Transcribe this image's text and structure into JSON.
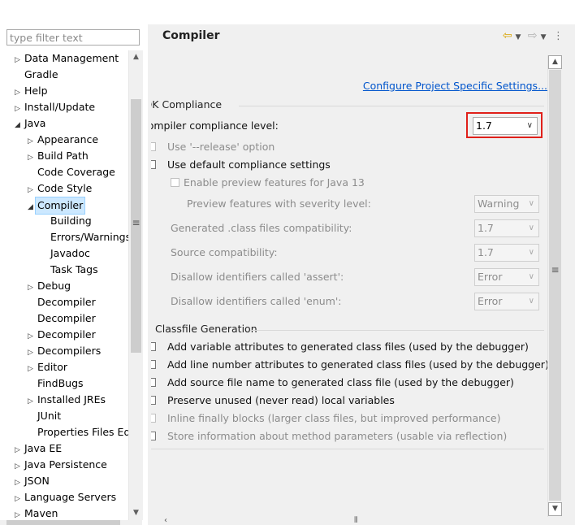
{
  "filter": {
    "placeholder": "type filter text"
  },
  "tree": {
    "items": [
      {
        "label": "Data Management",
        "twisty": "▷"
      },
      {
        "label": "Gradle",
        "twisty": ""
      },
      {
        "label": "Help",
        "twisty": "▷"
      },
      {
        "label": "Install/Update",
        "twisty": "▷"
      },
      {
        "label": "Java",
        "twisty": "◢"
      },
      {
        "label": "Appearance",
        "twisty": "▷"
      },
      {
        "label": "Build Path",
        "twisty": "▷"
      },
      {
        "label": "Code Coverage",
        "twisty": ""
      },
      {
        "label": "Code Style",
        "twisty": "▷"
      },
      {
        "label": "Compiler",
        "twisty": "◢"
      },
      {
        "label": "Building",
        "twisty": ""
      },
      {
        "label": "Errors/Warnings",
        "twisty": ""
      },
      {
        "label": "Javadoc",
        "twisty": ""
      },
      {
        "label": "Task Tags",
        "twisty": ""
      },
      {
        "label": "Debug",
        "twisty": "▷"
      },
      {
        "label": "Decompiler",
        "twisty": ""
      },
      {
        "label": "Decompiler",
        "twisty": ""
      },
      {
        "label": "Decompiler",
        "twisty": "▷"
      },
      {
        "label": "Decompilers",
        "twisty": "▷"
      },
      {
        "label": "Editor",
        "twisty": "▷"
      },
      {
        "label": "FindBugs",
        "twisty": ""
      },
      {
        "label": "Installed JREs",
        "twisty": "▷"
      },
      {
        "label": "JUnit",
        "twisty": ""
      },
      {
        "label": "Properties Files Edi",
        "twisty": ""
      },
      {
        "label": "Java EE",
        "twisty": "▷"
      },
      {
        "label": "Java Persistence",
        "twisty": "▷"
      },
      {
        "label": "JSON",
        "twisty": "▷"
      },
      {
        "label": "Language Servers",
        "twisty": "▷"
      },
      {
        "label": "Maven",
        "twisty": "▷"
      }
    ],
    "selected": "Compiler"
  },
  "page": {
    "title": "Compiler",
    "configure_link": "Configure Project Specific Settings..."
  },
  "jdk": {
    "section_title": "JDK Compliance",
    "compliance_label": "Compiler compliance level:",
    "compliance_value": "1.7",
    "release_label": "Use '--release' option",
    "default_label": "Use default compliance settings",
    "preview_label": "Enable preview features for Java 13",
    "severity_label": "Preview features with severity level:",
    "severity_value": "Warning",
    "generated_label": "Generated .class files compatibility:",
    "generated_value": "1.7",
    "source_label": "Source compatibility:",
    "source_value": "1.7",
    "assert_label": "Disallow identifiers called 'assert':",
    "assert_value": "Error",
    "enum_label": "Disallow identifiers called 'enum':",
    "enum_value": "Error"
  },
  "classfile": {
    "section_title": "Classfile Generation",
    "options": [
      {
        "label": "Add variable attributes to generated class files (used by the debugger)",
        "enabled": true
      },
      {
        "label": "Add line number attributes to generated class files (used by the debugger)",
        "enabled": true
      },
      {
        "label": "Add source file name to generated class file (used by the debugger)",
        "enabled": true
      },
      {
        "label": "Preserve unused (never read) local variables",
        "enabled": true
      },
      {
        "label": "Inline finally blocks (larger class files, but improved performance)",
        "enabled": false
      },
      {
        "label": "Store information about method parameters (usable via reflection)",
        "enabled": true
      }
    ]
  },
  "colors": {
    "accent_link": "#0055cc",
    "highlight": "#e0201a",
    "selection": "#cce8ff"
  }
}
